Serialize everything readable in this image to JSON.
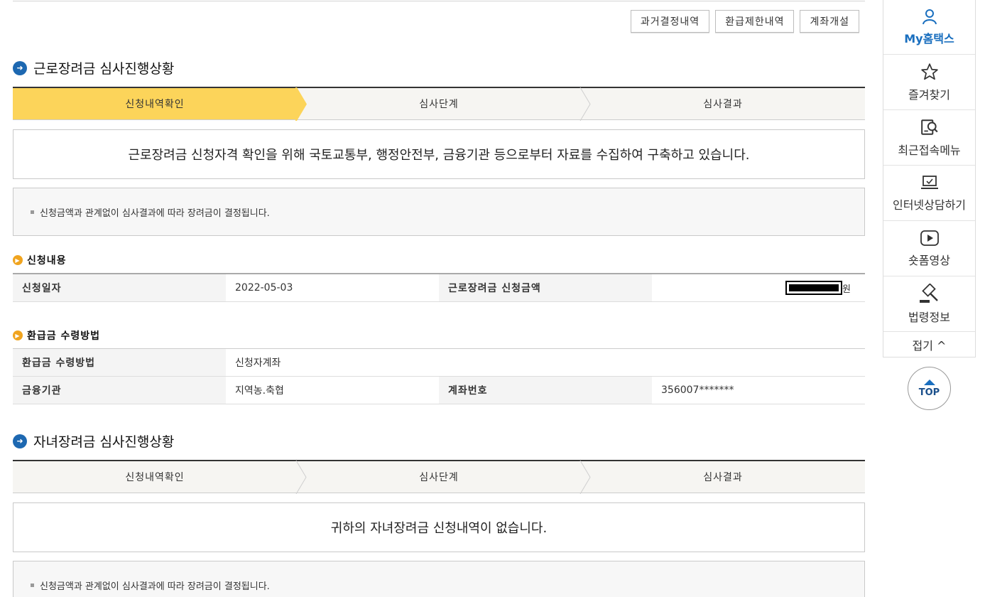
{
  "top_buttons": [
    "과거결정내역",
    "환급제한내역",
    "계좌개설"
  ],
  "section1": {
    "title": "근로장려금 심사진행상황",
    "steps": [
      "신청내역확인",
      "심사단계",
      "심사결과"
    ],
    "active_step": 0,
    "message": "근로장려금 신청자격 확인을 위해 국토교통부, 행정안전부, 금융기관 등으로부터 자료를 수집하여 구축하고 있습니다.",
    "note": "신청금액과 관계없이 심사결과에 따라 장려금이 결정됩니다."
  },
  "application": {
    "title": "신청내용",
    "date_label": "신청일자",
    "date_value": "2022-05-03",
    "amount_label": "근로장려금 신청금액",
    "amount_unit": "원"
  },
  "refund": {
    "title": "환급금 수령방법",
    "method_label": "환급금 수령방법",
    "method_value": "신청자계좌",
    "bank_label": "금융기관",
    "bank_value": "지역농.축협",
    "account_label": "계좌번호",
    "account_value": "356007*******"
  },
  "section2": {
    "title": "자녀장려금 심사진행상황",
    "steps": [
      "신청내역확인",
      "심사단계",
      "심사결과"
    ],
    "message": "귀하의 자녀장려금 신청내역이 없습니다.",
    "note": "신청금액과 관계없이 심사결과에 따라 장려금이 결정됩니다."
  },
  "sidebar": {
    "items": [
      {
        "label": "My홈택스",
        "icon": "person-icon"
      },
      {
        "label": "즐겨찾기",
        "icon": "star-icon"
      },
      {
        "label": "최근접속메뉴",
        "icon": "recent-search-icon"
      },
      {
        "label": "인터넷상담하기",
        "icon": "laptop-check-icon"
      },
      {
        "label": "숏폼영상",
        "icon": "play-icon"
      },
      {
        "label": "법령정보",
        "icon": "gavel-icon"
      }
    ],
    "fold_label": "접기 ^",
    "top_label": "TOP"
  }
}
